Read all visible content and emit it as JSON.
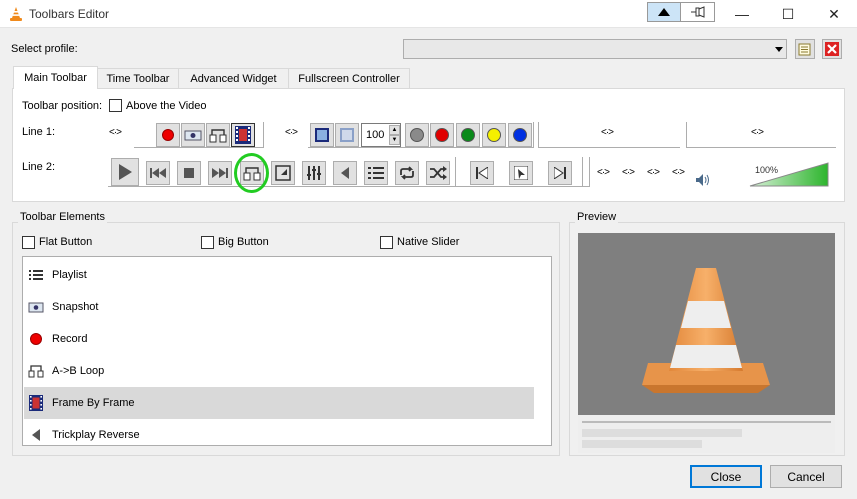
{
  "window": {
    "title": "Toolbars Editor",
    "minimize": "—",
    "maximize": "☐",
    "close": "✕"
  },
  "profile": {
    "label": "Select profile:",
    "value": ""
  },
  "tabs": [
    {
      "label": "Main Toolbar"
    },
    {
      "label": "Time Toolbar"
    },
    {
      "label": "Advanced Widget"
    },
    {
      "label": "Fullscreen Controller"
    }
  ],
  "toolbar_position": {
    "label": "Toolbar position:",
    "above_video_label": "Above the Video",
    "above_video_checked": false
  },
  "line1": {
    "label": "Line 1:",
    "volume_value": "100"
  },
  "line2": {
    "label": "Line 2:",
    "volume_percent": "100%",
    "volume_level": 1.0
  },
  "elements": {
    "group_title": "Toolbar Elements",
    "flat_button_label": "Flat Button",
    "big_button_label": "Big Button",
    "native_slider_label": "Native Slider",
    "items": [
      {
        "label": "Playlist",
        "icon": "playlist-icon"
      },
      {
        "label": "Snapshot",
        "icon": "snapshot-icon"
      },
      {
        "label": "Record",
        "icon": "record-icon"
      },
      {
        "label": "A->B Loop",
        "icon": "ab-loop-icon"
      },
      {
        "label": "Frame By Frame",
        "icon": "frame-by-frame-icon",
        "selected": true
      },
      {
        "label": "Trickplay Reverse",
        "icon": "trickplay-reverse-icon"
      }
    ]
  },
  "preview": {
    "title": "Preview"
  },
  "buttons": {
    "close": "Close",
    "cancel": "Cancel"
  },
  "colors": {
    "highlight_circle": "#22cc22",
    "volume_green": "#2db52d",
    "selection": "#d9d9d9",
    "accent": "#0078d7"
  }
}
